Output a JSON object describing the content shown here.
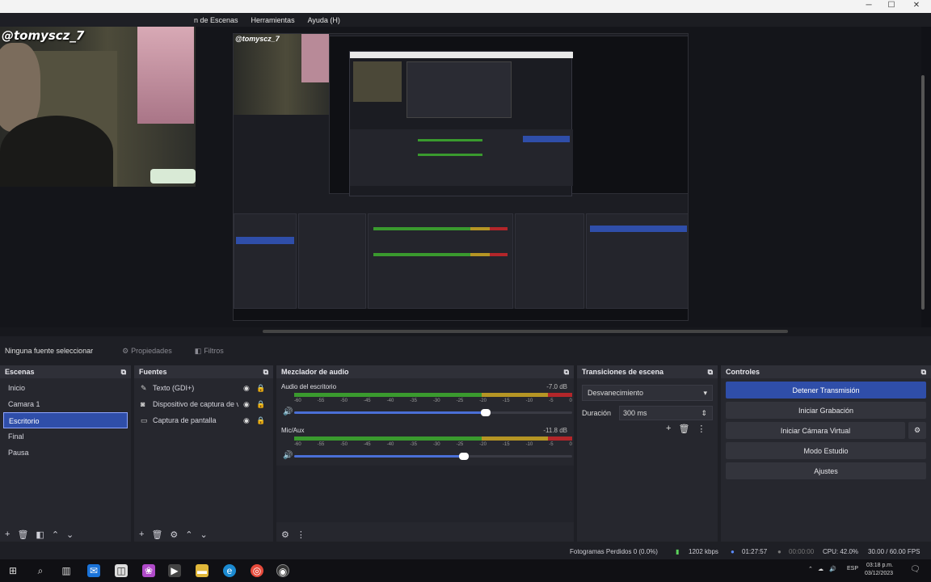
{
  "overlay": {
    "username": "@tomyscz_7"
  },
  "menu": {
    "items": [
      "n de Escenas",
      "Herramientas",
      "Ayuda (H)"
    ]
  },
  "window_controls": {
    "minimize": "─",
    "maximize": "☐",
    "close": "✕"
  },
  "source_toolbar": {
    "no_source_label": "Ninguna fuente seleccionar",
    "properties_label": "Propiedades",
    "filters_label": "Filtros"
  },
  "scenes": {
    "title": "Escenas",
    "items": [
      "Inicio",
      "Camara 1",
      "Escritorio",
      "Final",
      "Pausa"
    ],
    "selected_index": 2
  },
  "sources": {
    "title": "Fuentes",
    "items": [
      {
        "label": "Texto (GDI+)",
        "icon": "text-icon"
      },
      {
        "label": "Dispositivo de captura de v",
        "icon": "camera-icon"
      },
      {
        "label": "Captura de pantalla",
        "icon": "monitor-icon"
      }
    ]
  },
  "mixer": {
    "title": "Mezclador de audio",
    "channels": [
      {
        "name": "Audio del escritorio",
        "db": "-7.0 dB",
        "volume": 0.69
      },
      {
        "name": "Mic/Aux",
        "db": "-11.8 dB",
        "volume": 0.61
      }
    ],
    "ticks": [
      "-60",
      "-55",
      "-50",
      "-45",
      "-40",
      "-35",
      "-30",
      "-25",
      "-20",
      "-15",
      "-10",
      "-5",
      "0"
    ]
  },
  "transitions": {
    "title": "Transiciones de escena",
    "selected": "Desvanecimiento",
    "duration_label": "Duración",
    "duration_value": "300 ms"
  },
  "controls": {
    "title": "Controles",
    "buttons": [
      "Detener Transmisión",
      "Iniciar Grabación",
      "Iniciar Cámara Virtual",
      "Modo Estudio",
      "Ajustes"
    ]
  },
  "status": {
    "dropped_frames": "Fotogramas Perdidos 0 (0.0%)",
    "bitrate": "1202 kbps",
    "live_time": "01:27:57",
    "rec_time": "00:00:00",
    "cpu": "CPU: 42.0%",
    "fps": "30.00 / 60.00 FPS"
  },
  "taskbar": {
    "language": "ESP",
    "time": "03:18 p.m.",
    "date": "03/12/2023"
  },
  "colors": {
    "accent": "#2f4ea9",
    "meter_green": "#3a9a2e",
    "meter_yellow": "#b59524",
    "meter_red": "#b3262a"
  }
}
